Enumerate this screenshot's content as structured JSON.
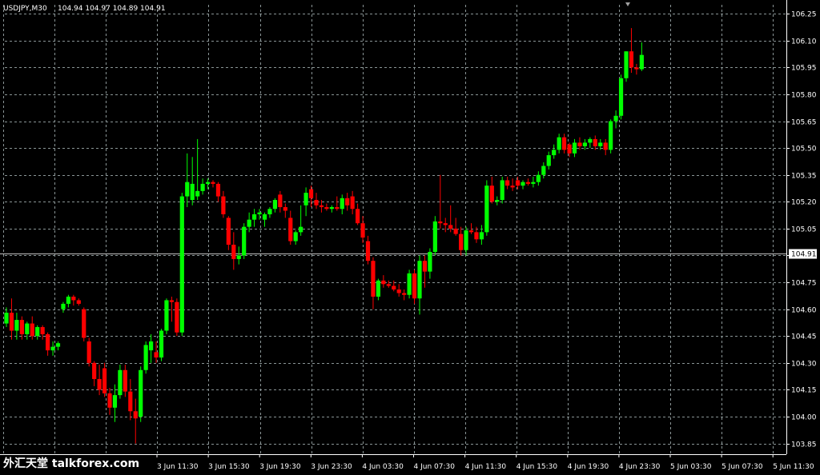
{
  "header": {
    "symbol": "USDJPY,M30",
    "ohlc": "104.94 104.97 104.89 104.91"
  },
  "current_price": "104.91",
  "watermark": "外汇天堂 talkforex.com",
  "colors": {
    "background": "#000000",
    "grid": "#8a9596",
    "axis": "#ffffff",
    "bull": "#00ff00",
    "bear": "#ff0000",
    "doji": "#0000ff",
    "price_line": "#c0c0c0"
  },
  "chart_data": {
    "type": "candlestick",
    "symbol": "USDJPY",
    "timeframe": "M30",
    "ylim": [
      103.79,
      106.3
    ],
    "y_ticks": [
      "106.25",
      "106.10",
      "105.95",
      "105.80",
      "105.65",
      "105.50",
      "105.35",
      "105.20",
      "105.05",
      "104.90",
      "104.75",
      "104.60",
      "104.45",
      "104.30",
      "104.15",
      "104.00",
      "103.85"
    ],
    "x_ticks": [
      "3 Jun 11:30",
      "3 Jun 15:30",
      "3 Jun 19:30",
      "3 Jun 23:30",
      "4 Jun 03:30",
      "4 Jun 07:30",
      "4 Jun 11:30",
      "4 Jun 15:30",
      "4 Jun 19:30",
      "4 Jun 23:30",
      "5 Jun 03:30",
      "5 Jun 07:30",
      "5 Jun 11:30"
    ],
    "grid": true,
    "candles": [
      [
        104.52,
        104.61,
        104.5,
        104.58
      ],
      [
        104.58,
        104.66,
        104.43,
        104.48
      ],
      [
        104.48,
        104.58,
        104.43,
        104.54
      ],
      [
        104.54,
        104.56,
        104.43,
        104.46
      ],
      [
        104.46,
        104.53,
        104.43,
        104.52
      ],
      [
        104.52,
        104.56,
        104.43,
        104.45
      ],
      [
        104.45,
        104.51,
        104.43,
        104.5
      ],
      [
        104.5,
        104.51,
        104.43,
        104.46
      ],
      [
        104.46,
        104.47,
        104.34,
        104.37
      ],
      [
        104.37,
        104.42,
        104.34,
        104.39
      ],
      [
        104.39,
        104.42,
        104.37,
        104.41
      ],
      [
        104.6,
        104.64,
        104.58,
        104.63
      ],
      [
        104.63,
        104.68,
        104.61,
        104.67
      ],
      [
        104.67,
        104.68,
        104.62,
        104.65
      ],
      [
        104.65,
        104.66,
        104.62,
        104.63
      ],
      [
        104.6,
        104.61,
        104.42,
        104.44
      ],
      [
        104.42,
        104.44,
        104.28,
        104.3
      ],
      [
        104.3,
        104.31,
        104.17,
        104.21
      ],
      [
        104.21,
        104.29,
        104.12,
        104.15
      ],
      [
        104.27,
        104.3,
        104.11,
        104.13
      ],
      [
        104.13,
        104.16,
        104.01,
        104.05
      ],
      [
        104.05,
        104.18,
        103.97,
        104.12
      ],
      [
        104.12,
        104.29,
        104.1,
        104.26
      ],
      [
        104.26,
        104.29,
        104.11,
        104.14
      ],
      [
        104.14,
        104.21,
        103.98,
        104.03
      ],
      [
        104.03,
        104.1,
        103.85,
        103.99
      ],
      [
        104.0,
        104.28,
        103.97,
        104.26
      ],
      [
        104.26,
        104.42,
        104.24,
        104.4
      ],
      [
        104.37,
        104.46,
        104.3,
        104.42
      ],
      [
        104.36,
        104.42,
        104.3,
        104.33
      ],
      [
        104.33,
        104.49,
        104.31,
        104.48
      ],
      [
        104.48,
        104.66,
        104.46,
        104.65
      ],
      [
        104.65,
        104.67,
        104.53,
        104.64
      ],
      [
        104.64,
        104.66,
        104.45,
        104.47
      ],
      [
        104.47,
        105.25,
        104.45,
        105.23
      ],
      [
        105.23,
        105.47,
        105.17,
        105.31
      ],
      [
        105.21,
        105.45,
        105.18,
        105.3
      ],
      [
        105.23,
        105.55,
        105.21,
        105.26
      ],
      [
        105.26,
        105.33,
        105.24,
        105.3
      ],
      [
        105.3,
        105.33,
        105.27,
        105.31
      ],
      [
        105.31,
        105.32,
        105.28,
        105.3
      ],
      [
        105.3,
        105.31,
        105.2,
        105.23
      ],
      [
        105.23,
        105.26,
        105.11,
        105.13
      ],
      [
        105.11,
        105.12,
        104.93,
        104.96
      ],
      [
        104.96,
        105.03,
        104.82,
        104.88
      ],
      [
        104.88,
        104.95,
        104.85,
        104.9
      ],
      [
        104.9,
        105.08,
        104.88,
        105.06
      ],
      [
        105.06,
        105.14,
        105.03,
        105.1
      ],
      [
        105.1,
        105.16,
        105.06,
        105.13
      ],
      [
        105.13,
        105.16,
        105.1,
        105.14
      ],
      [
        105.1,
        105.14,
        105.06,
        105.13
      ],
      [
        105.13,
        105.17,
        105.11,
        105.16
      ],
      [
        105.16,
        105.22,
        105.14,
        105.21
      ],
      [
        105.24,
        105.26,
        105.14,
        105.17
      ],
      [
        105.17,
        105.19,
        105.11,
        105.15
      ],
      [
        105.11,
        105.15,
        104.96,
        104.98
      ],
      [
        104.98,
        105.04,
        104.96,
        105.03
      ],
      [
        105.03,
        105.18,
        105.01,
        105.06
      ],
      [
        105.18,
        105.28,
        105.12,
        105.25
      ],
      [
        105.27,
        105.29,
        105.17,
        105.22
      ],
      [
        105.21,
        105.25,
        105.16,
        105.18
      ],
      [
        105.18,
        105.21,
        105.14,
        105.17
      ],
      [
        105.17,
        105.19,
        105.15,
        105.16
      ],
      [
        105.16,
        105.18,
        105.14,
        105.17
      ],
      [
        105.17,
        105.23,
        105.15,
        105.16
      ],
      [
        105.16,
        105.24,
        105.13,
        105.22
      ],
      [
        105.22,
        105.25,
        105.15,
        105.18
      ],
      [
        105.23,
        105.26,
        105.13,
        105.16
      ],
      [
        105.16,
        105.19,
        105.07,
        105.08
      ],
      [
        105.08,
        105.12,
        104.97,
        105.0
      ],
      [
        104.98,
        105.01,
        104.85,
        104.87
      ],
      [
        104.87,
        104.89,
        104.6,
        104.67
      ],
      [
        104.67,
        104.77,
        104.65,
        104.76
      ],
      [
        104.76,
        104.79,
        104.72,
        104.74
      ],
      [
        104.74,
        104.76,
        104.72,
        104.73
      ],
      [
        104.73,
        104.76,
        104.7,
        104.71
      ],
      [
        104.71,
        104.74,
        104.67,
        104.69
      ],
      [
        104.69,
        104.71,
        104.65,
        104.68
      ],
      [
        104.68,
        104.82,
        104.66,
        104.8
      ],
      [
        104.8,
        104.82,
        104.63,
        104.66
      ],
      [
        104.66,
        104.9,
        104.57,
        104.87
      ],
      [
        104.87,
        104.9,
        104.72,
        104.81
      ],
      [
        104.81,
        104.94,
        104.77,
        104.92
      ],
      [
        104.92,
        105.12,
        104.9,
        105.09
      ],
      [
        105.09,
        105.35,
        105.05,
        105.08
      ],
      [
        105.08,
        105.11,
        105.03,
        105.07
      ],
      [
        105.07,
        105.18,
        105.03,
        105.05
      ],
      [
        105.05,
        105.11,
        105.01,
        105.02
      ],
      [
        105.02,
        105.06,
        104.9,
        104.93
      ],
      [
        104.93,
        105.06,
        104.9,
        105.04
      ],
      [
        105.04,
        105.08,
        105.02,
        105.03
      ],
      [
        105.03,
        105.06,
        104.97,
        104.99
      ],
      [
        104.99,
        105.07,
        104.96,
        105.03
      ],
      [
        105.03,
        105.32,
        105.01,
        105.29
      ],
      [
        105.29,
        105.34,
        105.19,
        105.2
      ],
      [
        105.2,
        105.23,
        105.18,
        105.21
      ],
      [
        105.21,
        105.34,
        105.19,
        105.32
      ],
      [
        105.32,
        105.34,
        105.27,
        105.29
      ],
      [
        105.29,
        105.33,
        105.26,
        105.28
      ],
      [
        105.32,
        105.34,
        105.27,
        105.29
      ],
      [
        105.29,
        105.32,
        105.27,
        105.31
      ],
      [
        105.31,
        105.33,
        105.29,
        105.3
      ],
      [
        105.3,
        105.34,
        105.28,
        105.31
      ],
      [
        105.31,
        105.37,
        105.29,
        105.35
      ],
      [
        105.35,
        105.42,
        105.33,
        105.4
      ],
      [
        105.4,
        105.48,
        105.38,
        105.46
      ],
      [
        105.46,
        105.52,
        105.44,
        105.49
      ],
      [
        105.49,
        105.58,
        105.47,
        105.56
      ],
      [
        105.56,
        105.58,
        105.47,
        105.49
      ],
      [
        105.52,
        105.53,
        105.45,
        105.47
      ],
      [
        105.47,
        105.55,
        105.45,
        105.53
      ],
      [
        105.53,
        105.56,
        105.49,
        105.51
      ],
      [
        105.51,
        105.55,
        105.49,
        105.53
      ],
      [
        105.53,
        105.56,
        105.5,
        105.55
      ],
      [
        105.55,
        105.57,
        105.49,
        105.51
      ],
      [
        105.51,
        105.55,
        105.49,
        105.53
      ],
      [
        105.53,
        105.55,
        105.46,
        105.49
      ],
      [
        105.49,
        105.66,
        105.47,
        105.65
      ],
      [
        105.65,
        105.71,
        105.61,
        105.68
      ],
      [
        105.68,
        105.91,
        105.66,
        105.89
      ],
      [
        105.89,
        106.04,
        105.87,
        106.04
      ],
      [
        106.04,
        106.17,
        105.92,
        105.95
      ],
      [
        105.95,
        105.97,
        105.91,
        105.94
      ],
      [
        105.94,
        106.09,
        105.93,
        106.02
      ]
    ]
  }
}
